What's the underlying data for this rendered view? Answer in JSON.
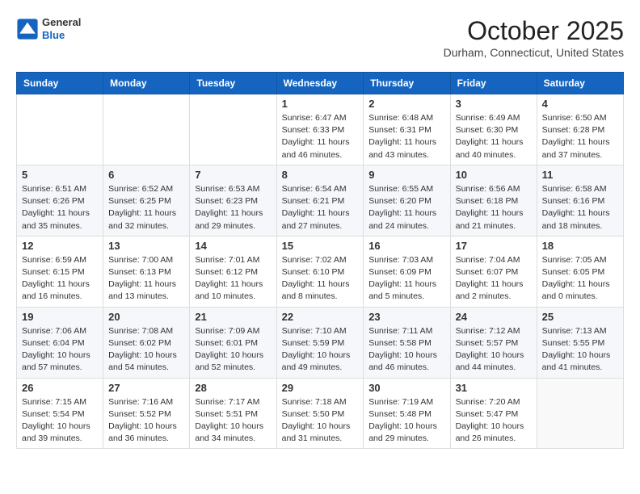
{
  "header": {
    "logo": {
      "general": "General",
      "blue": "Blue"
    },
    "title": "October 2025",
    "location": "Durham, Connecticut, United States"
  },
  "weekdays": [
    "Sunday",
    "Monday",
    "Tuesday",
    "Wednesday",
    "Thursday",
    "Friday",
    "Saturday"
  ],
  "weeks": [
    [
      {
        "day": "",
        "info": ""
      },
      {
        "day": "",
        "info": ""
      },
      {
        "day": "",
        "info": ""
      },
      {
        "day": "1",
        "info": "Sunrise: 6:47 AM\nSunset: 6:33 PM\nDaylight: 11 hours and 46 minutes."
      },
      {
        "day": "2",
        "info": "Sunrise: 6:48 AM\nSunset: 6:31 PM\nDaylight: 11 hours and 43 minutes."
      },
      {
        "day": "3",
        "info": "Sunrise: 6:49 AM\nSunset: 6:30 PM\nDaylight: 11 hours and 40 minutes."
      },
      {
        "day": "4",
        "info": "Sunrise: 6:50 AM\nSunset: 6:28 PM\nDaylight: 11 hours and 37 minutes."
      }
    ],
    [
      {
        "day": "5",
        "info": "Sunrise: 6:51 AM\nSunset: 6:26 PM\nDaylight: 11 hours and 35 minutes."
      },
      {
        "day": "6",
        "info": "Sunrise: 6:52 AM\nSunset: 6:25 PM\nDaylight: 11 hours and 32 minutes."
      },
      {
        "day": "7",
        "info": "Sunrise: 6:53 AM\nSunset: 6:23 PM\nDaylight: 11 hours and 29 minutes."
      },
      {
        "day": "8",
        "info": "Sunrise: 6:54 AM\nSunset: 6:21 PM\nDaylight: 11 hours and 27 minutes."
      },
      {
        "day": "9",
        "info": "Sunrise: 6:55 AM\nSunset: 6:20 PM\nDaylight: 11 hours and 24 minutes."
      },
      {
        "day": "10",
        "info": "Sunrise: 6:56 AM\nSunset: 6:18 PM\nDaylight: 11 hours and 21 minutes."
      },
      {
        "day": "11",
        "info": "Sunrise: 6:58 AM\nSunset: 6:16 PM\nDaylight: 11 hours and 18 minutes."
      }
    ],
    [
      {
        "day": "12",
        "info": "Sunrise: 6:59 AM\nSunset: 6:15 PM\nDaylight: 11 hours and 16 minutes."
      },
      {
        "day": "13",
        "info": "Sunrise: 7:00 AM\nSunset: 6:13 PM\nDaylight: 11 hours and 13 minutes."
      },
      {
        "day": "14",
        "info": "Sunrise: 7:01 AM\nSunset: 6:12 PM\nDaylight: 11 hours and 10 minutes."
      },
      {
        "day": "15",
        "info": "Sunrise: 7:02 AM\nSunset: 6:10 PM\nDaylight: 11 hours and 8 minutes."
      },
      {
        "day": "16",
        "info": "Sunrise: 7:03 AM\nSunset: 6:09 PM\nDaylight: 11 hours and 5 minutes."
      },
      {
        "day": "17",
        "info": "Sunrise: 7:04 AM\nSunset: 6:07 PM\nDaylight: 11 hours and 2 minutes."
      },
      {
        "day": "18",
        "info": "Sunrise: 7:05 AM\nSunset: 6:05 PM\nDaylight: 11 hours and 0 minutes."
      }
    ],
    [
      {
        "day": "19",
        "info": "Sunrise: 7:06 AM\nSunset: 6:04 PM\nDaylight: 10 hours and 57 minutes."
      },
      {
        "day": "20",
        "info": "Sunrise: 7:08 AM\nSunset: 6:02 PM\nDaylight: 10 hours and 54 minutes."
      },
      {
        "day": "21",
        "info": "Sunrise: 7:09 AM\nSunset: 6:01 PM\nDaylight: 10 hours and 52 minutes."
      },
      {
        "day": "22",
        "info": "Sunrise: 7:10 AM\nSunset: 5:59 PM\nDaylight: 10 hours and 49 minutes."
      },
      {
        "day": "23",
        "info": "Sunrise: 7:11 AM\nSunset: 5:58 PM\nDaylight: 10 hours and 46 minutes."
      },
      {
        "day": "24",
        "info": "Sunrise: 7:12 AM\nSunset: 5:57 PM\nDaylight: 10 hours and 44 minutes."
      },
      {
        "day": "25",
        "info": "Sunrise: 7:13 AM\nSunset: 5:55 PM\nDaylight: 10 hours and 41 minutes."
      }
    ],
    [
      {
        "day": "26",
        "info": "Sunrise: 7:15 AM\nSunset: 5:54 PM\nDaylight: 10 hours and 39 minutes."
      },
      {
        "day": "27",
        "info": "Sunrise: 7:16 AM\nSunset: 5:52 PM\nDaylight: 10 hours and 36 minutes."
      },
      {
        "day": "28",
        "info": "Sunrise: 7:17 AM\nSunset: 5:51 PM\nDaylight: 10 hours and 34 minutes."
      },
      {
        "day": "29",
        "info": "Sunrise: 7:18 AM\nSunset: 5:50 PM\nDaylight: 10 hours and 31 minutes."
      },
      {
        "day": "30",
        "info": "Sunrise: 7:19 AM\nSunset: 5:48 PM\nDaylight: 10 hours and 29 minutes."
      },
      {
        "day": "31",
        "info": "Sunrise: 7:20 AM\nSunset: 5:47 PM\nDaylight: 10 hours and 26 minutes."
      },
      {
        "day": "",
        "info": ""
      }
    ]
  ]
}
